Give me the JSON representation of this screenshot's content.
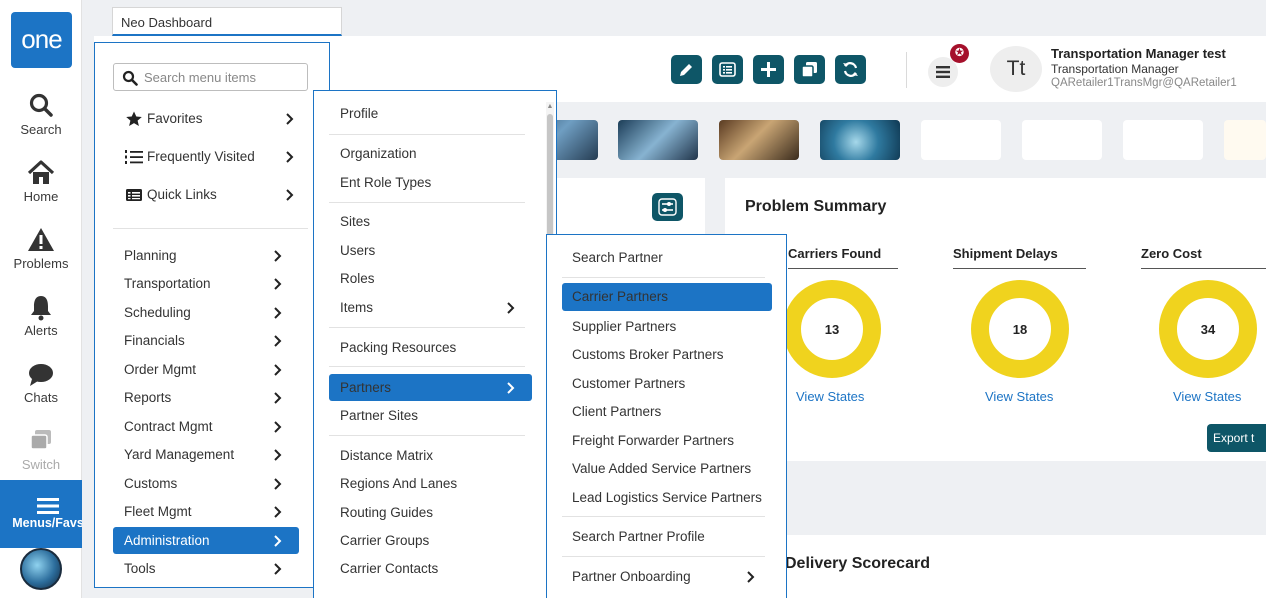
{
  "app": {
    "logo_text": "one",
    "tab_title": "Neo Dashboard",
    "brand_color": "#1c74c5",
    "tool_color": "#0e5667"
  },
  "rail": {
    "items": [
      {
        "label": "Search",
        "icon": "search-icon"
      },
      {
        "label": "Home",
        "icon": "home-icon"
      },
      {
        "label": "Problems",
        "icon": "warning-icon"
      },
      {
        "label": "Alerts",
        "icon": "bell-icon"
      },
      {
        "label": "Chats",
        "icon": "chat-icon"
      },
      {
        "label": "Switch",
        "icon": "switch-icon"
      }
    ],
    "active": {
      "label": "Menus/Favs",
      "icon": "hamburger-icon"
    }
  },
  "header": {
    "notification_count": "✪",
    "avatar_initials": "Tt",
    "user_name": "Transportation Manager test",
    "user_role": "Transportation Manager",
    "user_id": "QARetailer1TransMgr@QARetailer1",
    "tools": [
      "edit-icon",
      "list-icon",
      "add-icon",
      "copy-icon",
      "refresh-icon"
    ]
  },
  "menu1": {
    "search_placeholder": "Search menu items",
    "quick": [
      {
        "label": "Favorites",
        "icon": "star-icon"
      },
      {
        "label": "Frequently Visited",
        "icon": "ordered-list-icon"
      },
      {
        "label": "Quick Links",
        "icon": "links-icon"
      }
    ],
    "items": [
      {
        "label": "Planning"
      },
      {
        "label": "Transportation"
      },
      {
        "label": "Scheduling"
      },
      {
        "label": "Financials"
      },
      {
        "label": "Order Mgmt"
      },
      {
        "label": "Reports"
      },
      {
        "label": "Contract Mgmt"
      },
      {
        "label": "Yard Management"
      },
      {
        "label": "Customs"
      },
      {
        "label": "Fleet Mgmt"
      },
      {
        "label": "Administration"
      },
      {
        "label": "Tools"
      }
    ]
  },
  "menu2": {
    "items": [
      {
        "label": "Profile"
      },
      {
        "label": "Organization"
      },
      {
        "label": "Ent Role Types"
      },
      {
        "label": "Sites"
      },
      {
        "label": "Users"
      },
      {
        "label": "Roles"
      },
      {
        "label": "Items"
      },
      {
        "label": "Packing Resources"
      },
      {
        "label": "Partners"
      },
      {
        "label": "Partner Sites"
      },
      {
        "label": "Distance Matrix"
      },
      {
        "label": "Regions And Lanes"
      },
      {
        "label": "Routing Guides"
      },
      {
        "label": "Carrier Groups"
      },
      {
        "label": "Carrier Contacts"
      }
    ]
  },
  "menu3": {
    "items": [
      {
        "label": "Search Partner"
      },
      {
        "label": "Carrier Partners"
      },
      {
        "label": "Supplier Partners"
      },
      {
        "label": "Customs Broker Partners"
      },
      {
        "label": "Customer Partners"
      },
      {
        "label": "Client Partners"
      },
      {
        "label": "Freight Forwarder Partners"
      },
      {
        "label": "Value Added Service Partners"
      },
      {
        "label": "Lead Logistics Service Partners"
      },
      {
        "label": "Search Partner Profile"
      },
      {
        "label": "Partner Onboarding"
      }
    ]
  },
  "problem_summary": {
    "title": "Problem Summary",
    "metrics": [
      {
        "title": "Carriers Found",
        "value": "13",
        "link": "View States"
      },
      {
        "title": "Shipment Delays",
        "value": "18",
        "link": "View States"
      },
      {
        "title": "Zero Cost",
        "value": "34",
        "link": "View States"
      }
    ],
    "export_label": "Export t",
    "donut_color": "#f0d31e"
  },
  "delivery": {
    "title": "Delivery Scorecard"
  }
}
